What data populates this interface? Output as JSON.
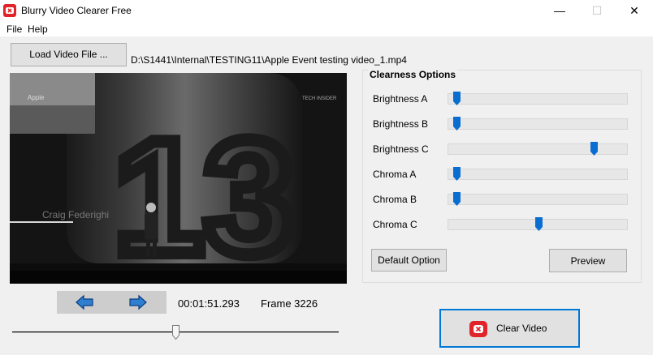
{
  "window": {
    "title": "Blurry Video Clearer Free",
    "minimize": "—",
    "maximize": "☐",
    "close": "✕"
  },
  "menu": {
    "file": "File",
    "help": "Help"
  },
  "toolbar": {
    "load_label": "Load Video File ...",
    "file_path": "D:\\S1441\\Internal\\TESTING11\\Apple Event testing video_1.mp4"
  },
  "video": {
    "overlay_brand": "Apple",
    "overlay_source": "TECH INSIDER",
    "overlay_name": "Craig Federighi",
    "big_number": "13"
  },
  "playback": {
    "timecode": "00:01:51.293",
    "frame": "Frame 3226",
    "position_fraction": 0.5
  },
  "options": {
    "group_title": "Clearness Options",
    "sliders": [
      {
        "label": "Brightness A",
        "value": 0.03
      },
      {
        "label": "Brightness B",
        "value": 0.03
      },
      {
        "label": "Brightness C",
        "value": 0.82
      },
      {
        "label": "Chroma A",
        "value": 0.03
      },
      {
        "label": "Chroma B",
        "value": 0.03
      },
      {
        "label": "Chroma C",
        "value": 0.5
      }
    ],
    "default_label": "Default Option",
    "preview_label": "Preview"
  },
  "clear": {
    "label": "Clear Video"
  },
  "colors": {
    "accent": "#0078d7",
    "thumb": "#0a6ed1",
    "brand_red": "#e0242a"
  }
}
